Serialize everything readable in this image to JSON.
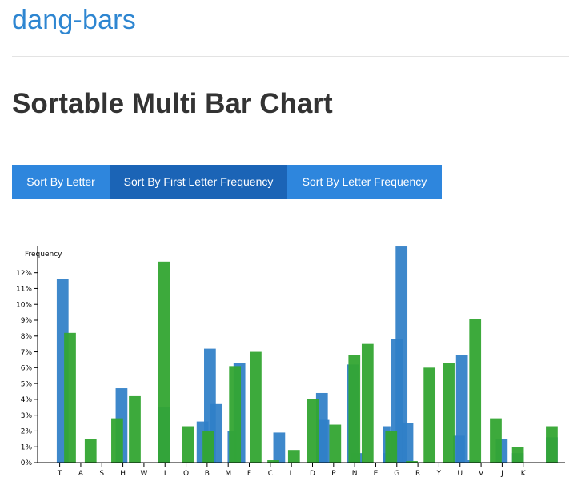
{
  "header": {
    "site_title": "dang-bars",
    "page_title": "Sortable Multi Bar Chart"
  },
  "controls": {
    "buttons": [
      {
        "label": "Sort By Letter",
        "active": false
      },
      {
        "label": "Sort By First Letter Frequency",
        "active": true
      },
      {
        "label": "Sort By Letter Frequency",
        "active": false
      }
    ]
  },
  "colors": {
    "series_a": "#2f7fc7",
    "series_b": "#33a532",
    "button": "#2e86dd",
    "button_active": "#1b64b6"
  },
  "chart_data": {
    "type": "bar",
    "ylabel": "Frequency",
    "ylim": [
      0,
      13.5
    ],
    "yticks": [
      0,
      1,
      2,
      3,
      4,
      5,
      6,
      7,
      8,
      9,
      10,
      11,
      12
    ],
    "tick_suffix": "%",
    "grid": false,
    "x_labels": [
      "T",
      "A",
      "S",
      "H",
      "W",
      "I",
      "O",
      "B",
      "M",
      "F",
      "C",
      "L",
      "D",
      "P",
      "N",
      "E",
      "G",
      "R",
      "Y",
      "U",
      "V",
      "J",
      "K"
    ],
    "series": [
      {
        "values": [
          11.6,
          null,
          4.7,
          null,
          3.5,
          2.6,
          7.2,
          3.7,
          2.0,
          6.3,
          null,
          1.9,
          null,
          null,
          4.4,
          2.7,
          6.2,
          0.6,
          2.3,
          0.6,
          7.8,
          13.7,
          2.5,
          null,
          null,
          1.7,
          6.8,
          0.15,
          null,
          1.5,
          0.6,
          null,
          1.6
        ],
        "centers": [
          1.7,
          null,
          5.7,
          null,
          8.6,
          11.2,
          11.7,
          12.1,
          13.2,
          13.7,
          null,
          16.4,
          null,
          null,
          19.3,
          19.4,
          21.4,
          21.7,
          23.7,
          23.7,
          24.4,
          24.7,
          25.1,
          null,
          null,
          28.6,
          28.8,
          29.6,
          null,
          31.5,
          32.6,
          null,
          34.9
        ],
        "widths": [
          0.8,
          null,
          0.8,
          null,
          0.8,
          0.8,
          0.8,
          0.8,
          0.6,
          0.8,
          null,
          0.8,
          null,
          null,
          0.8,
          0.8,
          0.8,
          0.8,
          0.5,
          0.5,
          0.8,
          0.8,
          0.8,
          null,
          null,
          0.8,
          0.8,
          0.8,
          null,
          0.8,
          0.8,
          null,
          0.8
        ]
      },
      {
        "values": [
          8.2,
          1.5,
          2.8,
          4.2,
          12.7,
          2.3,
          2.0,
          6.1,
          7.0,
          0.15,
          0.8,
          4.0,
          2.4,
          6.8,
          7.5,
          2.0,
          0.1,
          6.0,
          6.3,
          9.1,
          2.8,
          1.0,
          2.3
        ],
        "centers": [
          2.2,
          3.6,
          5.4,
          6.6,
          8.6,
          10.2,
          11.6,
          13.4,
          14.8,
          16.0,
          17.4,
          18.7,
          20.2,
          21.5,
          22.4,
          24.0,
          25.4,
          26.6,
          27.9,
          29.7,
          31.1,
          32.6,
          34.9
        ],
        "widths": [
          0.8,
          0.8,
          0.8,
          0.8,
          0.8,
          0.8,
          0.8,
          0.8,
          0.8,
          0.8,
          0.8,
          0.8,
          0.8,
          0.8,
          0.8,
          0.8,
          0.8,
          0.8,
          0.8,
          0.8,
          0.8,
          0.8,
          0.8
        ]
      }
    ]
  }
}
